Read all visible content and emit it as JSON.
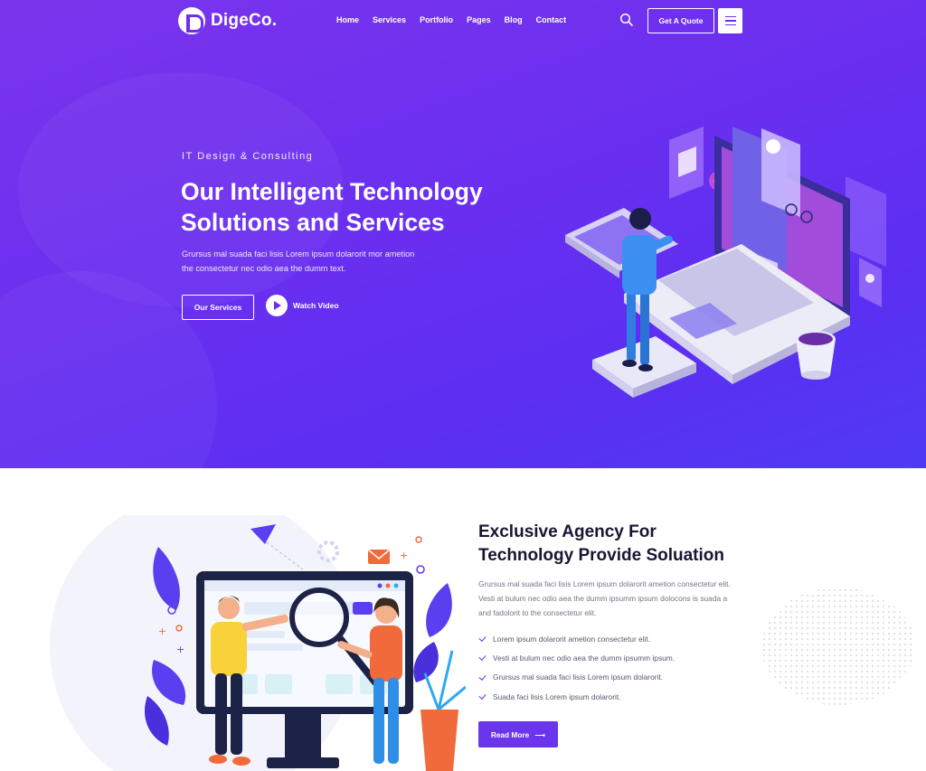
{
  "brand": {
    "name": "DigeCo."
  },
  "nav": {
    "items": [
      {
        "label": "Home"
      },
      {
        "label": "Services"
      },
      {
        "label": "Portfolio"
      },
      {
        "label": "Pages"
      },
      {
        "label": "Blog"
      },
      {
        "label": "Contact"
      }
    ],
    "quote_label": "Get A Quote"
  },
  "hero": {
    "eyebrow": "IT Design & Consulting",
    "title_line1": "Our Intelligent Technology",
    "title_line2": "Solutions and Services",
    "text_line1": "Grursus mal suada faci lisis Lorem ipsum dolarorit mor ametion",
    "text_line2": "the consectetur nec odio aea the dumm text.",
    "primary_button": "Our Services",
    "video_button": "Watch Video"
  },
  "about": {
    "title_line1": "Exclusive Agency For",
    "title_line2": "Technology Provide Soluation",
    "text_line1": "Grursus mal suada faci lisis Lorem ipsum dolarorit ametion consectetur elit.",
    "text_line2": "Vesti at bulum nec odio aea the dumm ipsumm ipsum dolocons is suada a",
    "text_line3": "and fadolorit to the consectetur elit.",
    "checklist": [
      {
        "text": "Lorem ipsum dolarorit ametion consectetur elit."
      },
      {
        "text": "Vesti at bulum nec odio aea the dumm ipsumm ipsum."
      },
      {
        "text": "Grursus mal suada faci lisis Lorem ipsum dolarorit."
      },
      {
        "text": "Suada faci lisis Lorem ipsum dolarorit."
      }
    ],
    "read_more": "Read More",
    "read_more_arrow": "⟶"
  },
  "colors": {
    "hero_gradient_start": "#7b34ec",
    "hero_gradient_end": "#4f3af4",
    "accent": "#6a35ec",
    "heading": "#161632",
    "body_text": "#757588"
  }
}
